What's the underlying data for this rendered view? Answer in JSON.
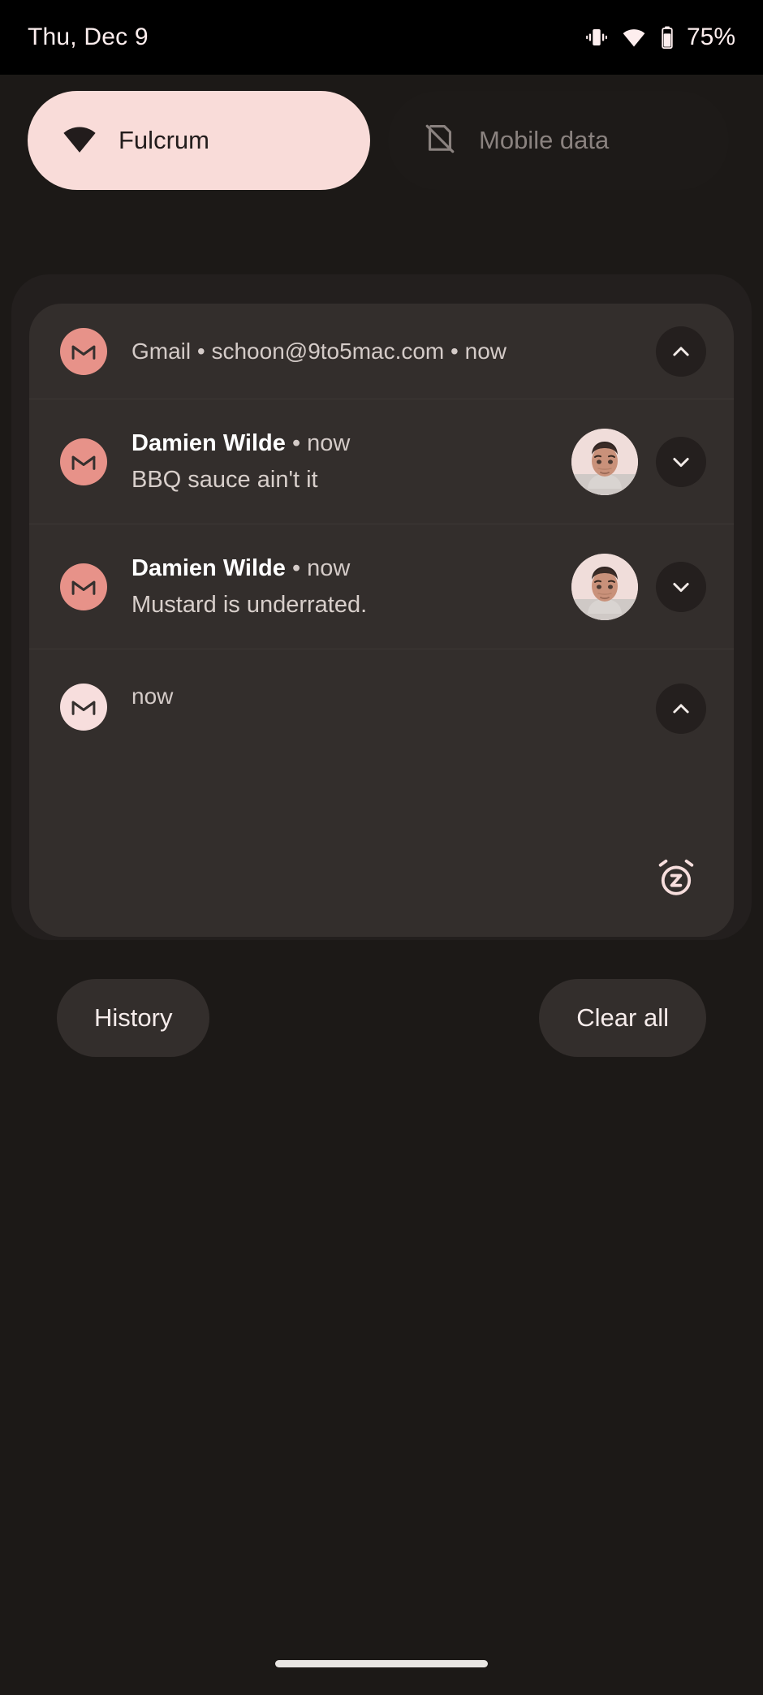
{
  "status_bar": {
    "date": "Thu, Dec 9",
    "battery_percent": "75%",
    "icons": [
      "vibrate-icon",
      "wifi-icon",
      "battery-icon"
    ]
  },
  "quick_settings": {
    "tiles": [
      {
        "label": "Fulcrum",
        "icon": "wifi-icon",
        "state": "on",
        "bg": "#f9dcd9",
        "fg": "#221c1c"
      },
      {
        "label": "Mobile data",
        "icon": "mobile-data-off-icon",
        "state": "off",
        "bg": "#1d1a18",
        "fg": "#8a827f"
      }
    ]
  },
  "notification_group": {
    "header": {
      "app_name": "Gmail",
      "account": "schoon@9to5mac.com",
      "timestamp": "now",
      "text": "Gmail • schoon@9to5mac.com • now",
      "icon": "gmail-icon",
      "icon_bg": "#e79289",
      "expand_icon": "chevron-up-icon"
    },
    "messages": [
      {
        "sender": "Damien Wilde",
        "separator": "•",
        "timestamp": "now",
        "body": "BBQ sauce ain't it",
        "icon": "gmail-icon",
        "icon_bg": "#e79289",
        "avatar": "contact-avatar",
        "expand_icon": "chevron-down-icon"
      },
      {
        "sender": "Damien Wilde",
        "separator": "•",
        "timestamp": "now",
        "body": "Mustard is underrated.",
        "icon": "gmail-icon",
        "icon_bg": "#e79289",
        "avatar": "contact-avatar",
        "expand_icon": "chevron-down-icon"
      }
    ],
    "footer": {
      "timestamp": "now",
      "icon": "gmail-icon",
      "icon_bg": "#f7dedd",
      "collapse_icon": "chevron-up-icon",
      "snooze_icon": "snooze-icon"
    }
  },
  "actions": {
    "history_label": "History",
    "clear_all_label": "Clear all"
  },
  "nav": {
    "gesture_bar": "home-gesture-bar"
  },
  "colors": {
    "screen_bg": "#1c1917",
    "status_bar_bg": "#000000",
    "shelf_bg": "#231f1e",
    "card_bg": "#332e2c",
    "accent_pink": "#f9dcd9",
    "gmail_salmon": "#e79289",
    "divider": "#3d3835",
    "text_primary": "#ffffff",
    "text_secondary": "#d4cbc8"
  }
}
